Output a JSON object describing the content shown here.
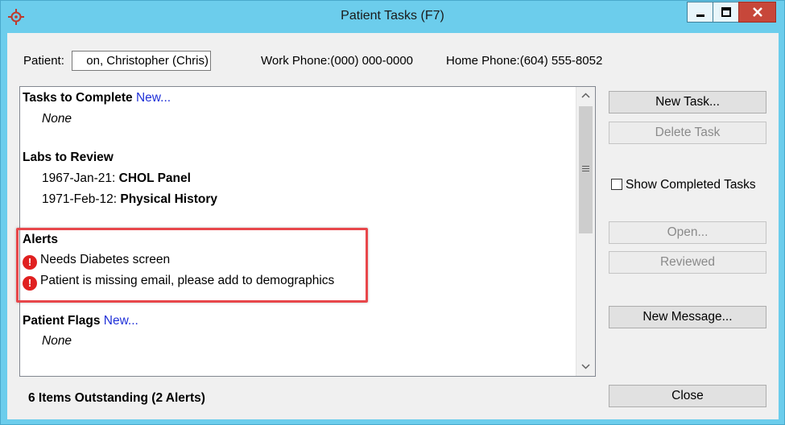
{
  "window": {
    "title": "Patient Tasks (F7)",
    "accent_color": "#6ccdec",
    "icons": {
      "app": "crosshair-app-icon",
      "minimize": "minimize-icon",
      "maximize": "maximize-icon",
      "close": "close-icon"
    }
  },
  "header": {
    "patient_label": "Patient:",
    "patient_value": "on, Christopher (Chris)",
    "work_phone": "Work Phone:(000) 000-0000",
    "home_phone": "Home Phone:(604) 555-8052"
  },
  "list": {
    "tasks": {
      "heading": "Tasks to Complete",
      "link": "New...",
      "empty": "None"
    },
    "labs": {
      "heading": "Labs to Review",
      "items": [
        {
          "date": "1967-Jan-21:",
          "name": "CHOL Panel"
        },
        {
          "date": "1971-Feb-12:",
          "name": "Physical History"
        }
      ]
    },
    "alerts": {
      "heading": "Alerts",
      "items": [
        "Needs Diabetes screen",
        "Patient is missing email, please add to demographics"
      ],
      "icon": "exclamation-icon",
      "icon_color": "#e02020",
      "highlight_color": "#e8474b"
    },
    "flags": {
      "heading": "Patient Flags",
      "link": "New...",
      "empty": "None"
    }
  },
  "buttons": {
    "new_task": "New Task...",
    "delete_task": "Delete Task",
    "show_completed": "Show Completed Tasks",
    "open": "Open...",
    "reviewed": "Reviewed",
    "new_message": "New Message...",
    "close": "Close"
  },
  "status": "6 Items Outstanding (2 Alerts)"
}
